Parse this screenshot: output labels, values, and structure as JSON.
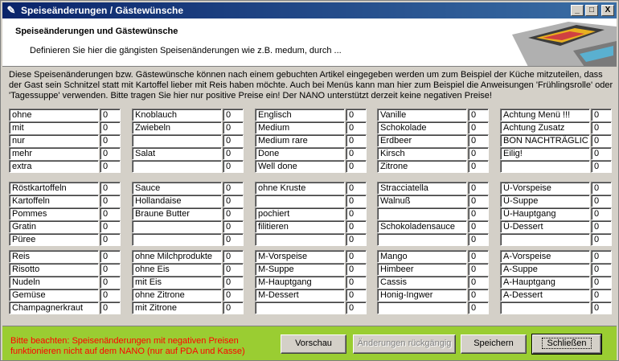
{
  "window": {
    "title": "Speiseänderungen / Gästewünsche",
    "minimize": "_",
    "maximize": "□",
    "close": "X"
  },
  "header": {
    "title": "Speiseänderungen und Gästewünsche",
    "subtitle": "Definieren Sie hier die gängisten Speisenänderungen wie z.B. medum, durch ..."
  },
  "description": "Diese Speisenänderungen bzw. Gästewünsche können nach einem gebuchten Artikel eingegeben werden um zum Beispiel der Küche mitzuteilen, dass der Gast sein Schnitzel statt mit Kartoffel lieber mit Reis haben möchte. Auch bei Menüs kann man hier zum Beispiel die Anweisungen 'Frühlingsrolle' oder 'Tagessuppe' verwenden. Bitte tragen Sie hier nur positive Preise ein! Der NANO unterstützt derzeit keine negativen Preise!",
  "columns": [
    {
      "groups": [
        [
          [
            "ohne",
            "0"
          ],
          [
            "mit",
            "0"
          ],
          [
            "nur",
            "0"
          ],
          [
            "mehr",
            "0"
          ],
          [
            "extra",
            "0"
          ]
        ],
        [
          [
            "Röstkartoffeln",
            "0"
          ],
          [
            "Kartoffeln",
            "0"
          ],
          [
            "Pommes",
            "0"
          ],
          [
            "Gratin",
            "0"
          ],
          [
            "Püree",
            "0"
          ]
        ],
        [
          [
            "Reis",
            "0"
          ],
          [
            "Risotto",
            "0"
          ],
          [
            "Nudeln",
            "0"
          ],
          [
            "Gemüse",
            "0"
          ],
          [
            "Champagnerkraut",
            "0"
          ]
        ]
      ]
    },
    {
      "groups": [
        [
          [
            "Knoblauch",
            "0"
          ],
          [
            "Zwiebeln",
            "0"
          ],
          [
            "",
            "0"
          ],
          [
            "Salat",
            "0"
          ],
          [
            "",
            "0"
          ]
        ],
        [
          [
            "Sauce",
            "0"
          ],
          [
            "Hollandaise",
            "0"
          ],
          [
            "Braune Butter",
            "0"
          ],
          [
            "",
            "0"
          ],
          [
            "",
            "0"
          ]
        ],
        [
          [
            "ohne Milchprodukte",
            "0"
          ],
          [
            "ohne Eis",
            "0"
          ],
          [
            "mit Eis",
            "0"
          ],
          [
            "ohne Zitrone",
            "0"
          ],
          [
            "mit Zitrone",
            "0"
          ]
        ]
      ]
    },
    {
      "groups": [
        [
          [
            "Englisch",
            "0"
          ],
          [
            "Medium",
            "0"
          ],
          [
            "Medium rare",
            "0"
          ],
          [
            "Done",
            "0"
          ],
          [
            "Well done",
            "0"
          ]
        ],
        [
          [
            "ohne Kruste",
            "0"
          ],
          [
            "",
            "0"
          ],
          [
            "pochiert",
            "0"
          ],
          [
            "filitieren",
            "0"
          ],
          [
            "",
            "0"
          ]
        ],
        [
          [
            "M-Vorspeise",
            "0"
          ],
          [
            "M-Suppe",
            "0"
          ],
          [
            "M-Hauptgang",
            "0"
          ],
          [
            "M-Dessert",
            "0"
          ],
          [
            "",
            "0"
          ]
        ]
      ]
    },
    {
      "groups": [
        [
          [
            "Vanille",
            "0"
          ],
          [
            "Schokolade",
            "0"
          ],
          [
            "Erdbeer",
            "0"
          ],
          [
            "Kirsch",
            "0"
          ],
          [
            "Zitrone",
            "0"
          ]
        ],
        [
          [
            "Stracciatella",
            "0"
          ],
          [
            "Walnuß",
            "0"
          ],
          [
            "",
            "0"
          ],
          [
            "Schokoladensauce",
            "0"
          ],
          [
            "",
            "0"
          ]
        ],
        [
          [
            "Mango",
            "0"
          ],
          [
            "Himbeer",
            "0"
          ],
          [
            "Cassis",
            "0"
          ],
          [
            "Honig-Ingwer",
            "0"
          ],
          [
            "",
            "0"
          ]
        ]
      ]
    },
    {
      "groups": [
        [
          [
            "Achtung Menü !!!",
            "0"
          ],
          [
            "Achtung Zusatz",
            "0"
          ],
          [
            "BON NACHTRÄGLIC",
            "0"
          ],
          [
            "Eilig!",
            "0"
          ],
          [
            "",
            "0"
          ]
        ],
        [
          [
            "Ü-Vorspeise",
            "0"
          ],
          [
            "Ü-Suppe",
            "0"
          ],
          [
            "Ü-Hauptgang",
            "0"
          ],
          [
            "Ü-Dessert",
            "0"
          ],
          [
            "",
            "0"
          ]
        ],
        [
          [
            "A-Vorspeise",
            "0"
          ],
          [
            "A-Suppe",
            "0"
          ],
          [
            "A-Hauptgang",
            "0"
          ],
          [
            "A-Dessert",
            "0"
          ],
          [
            "",
            "0"
          ]
        ]
      ]
    }
  ],
  "footer": {
    "warning": "Bitte beachten: Speisenänderungen mit negativen Preisen funktionieren nicht auf dem NANO (nur auf PDA und Kasse)",
    "buttons": {
      "preview": "Vorschau",
      "undo": "Änderungen rückgängig",
      "save": "Speichern",
      "close": "Schließen"
    }
  },
  "colors": {
    "titlebar": "#0a246a",
    "footer": "#9acd32",
    "warning": "#ff0000"
  }
}
